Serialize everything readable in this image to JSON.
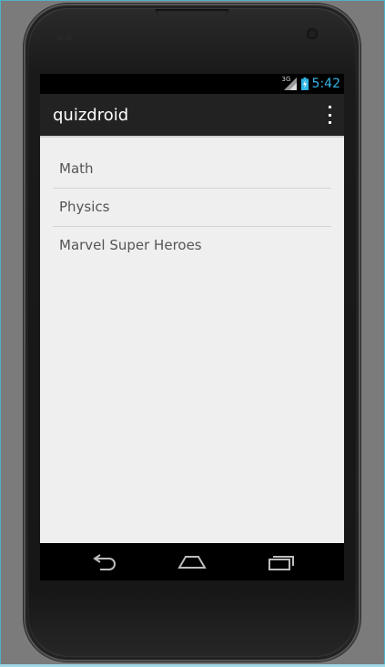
{
  "status_bar": {
    "network_type": "3G",
    "time": "5:42",
    "icons": [
      "signal-icon",
      "battery-icon"
    ],
    "clock_color": "#33b5e5"
  },
  "action_bar": {
    "title": "quizdroid",
    "overflow_icon": "overflow-menu-icon"
  },
  "quiz_list": {
    "items": [
      {
        "label": "Math"
      },
      {
        "label": "Physics"
      },
      {
        "label": "Marvel Super Heroes"
      }
    ]
  },
  "nav_bar": {
    "icons": [
      "back-icon",
      "home-icon",
      "recent-apps-icon"
    ]
  },
  "colors": {
    "action_bar": "#222222",
    "screen_background": "#efefef",
    "list_text": "#555555",
    "status_bar": "#000000"
  }
}
